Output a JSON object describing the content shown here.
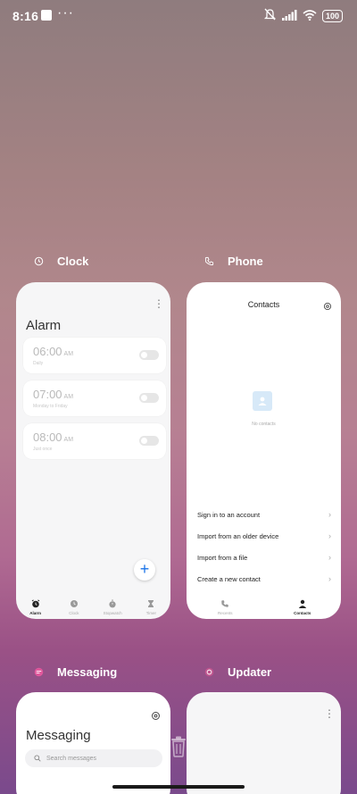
{
  "status_bar": {
    "time": "8:16",
    "dots": "···",
    "battery": "100"
  },
  "apps": {
    "clock": {
      "name": "Clock",
      "title": "Alarm",
      "alarms": [
        {
          "time": "06:00",
          "ampm": "AM",
          "sub": "Daily",
          "enabled": false
        },
        {
          "time": "07:00",
          "ampm": "AM",
          "sub": "Monday to Friday",
          "enabled": false
        },
        {
          "time": "08:00",
          "ampm": "AM",
          "sub": "Just once",
          "enabled": false
        }
      ],
      "fab": "+",
      "nav": [
        {
          "label": "Alarm",
          "icon": "alarm-icon",
          "active": true
        },
        {
          "label": "Clock",
          "icon": "clock-icon",
          "active": false
        },
        {
          "label": "Stopwatch",
          "icon": "stopwatch-icon",
          "active": false
        },
        {
          "label": "Timer",
          "icon": "timer-icon",
          "active": false
        }
      ]
    },
    "phone": {
      "name": "Phone",
      "title": "Contacts",
      "empty": "No contacts",
      "actions": [
        "Sign in to an account",
        "Import from an older device",
        "Import from a file",
        "Create a new contact"
      ],
      "nav": [
        {
          "label": "Recents",
          "icon": "phone-icon",
          "active": false
        },
        {
          "label": "Contacts",
          "icon": "person-icon",
          "active": true
        }
      ]
    },
    "messaging": {
      "name": "Messaging",
      "title": "Messaging",
      "search_placeholder": "Search messages"
    },
    "updater": {
      "name": "Updater"
    }
  },
  "colors": {
    "accent": "#1a73e8",
    "messaging_icon": "#e0589c",
    "updater_icon": "#c0558f"
  }
}
